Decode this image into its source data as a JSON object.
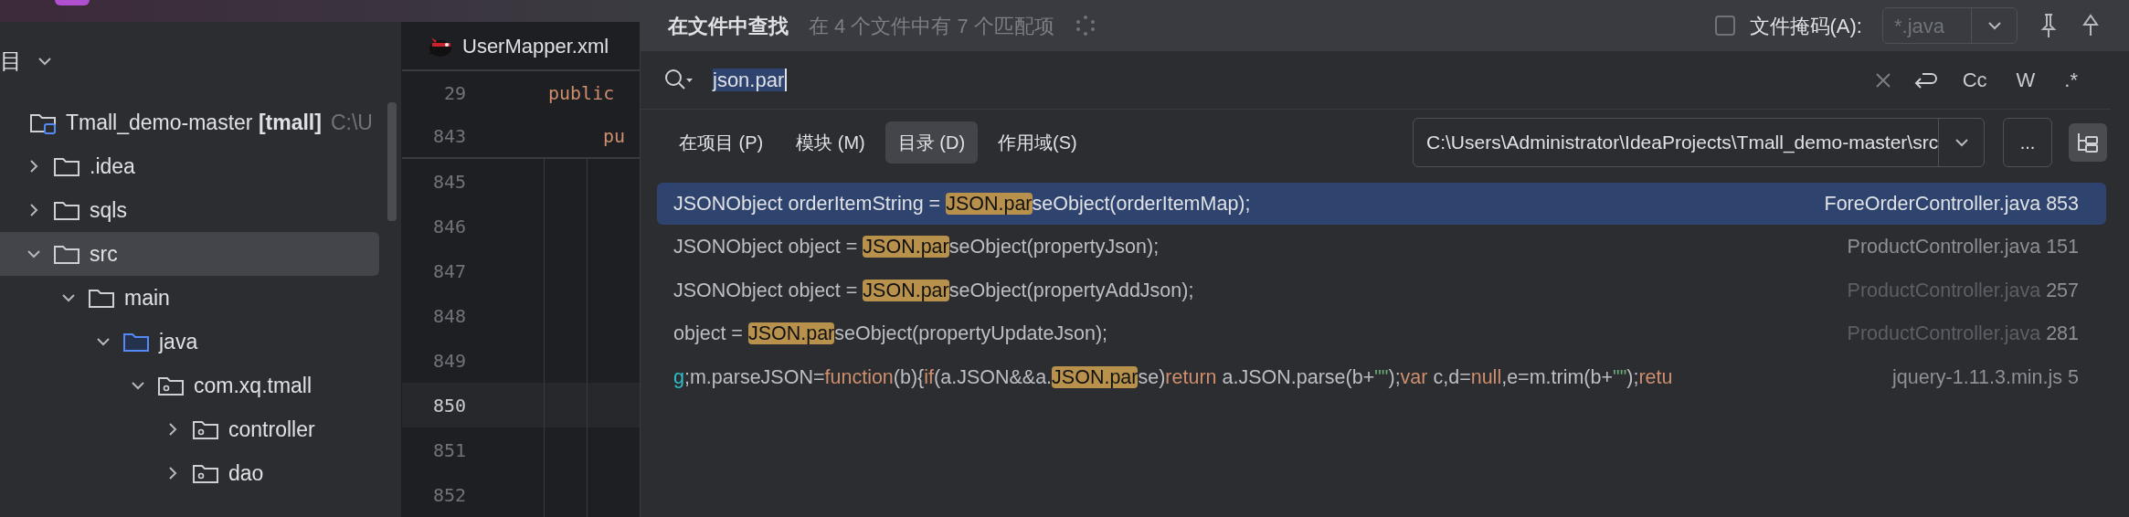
{
  "project_panel": {
    "title": "目",
    "tree": [
      {
        "label": "Tmall_demo-master **[tmall]**",
        "hint": "C:\\U",
        "kind": "module",
        "selected": false,
        "children": [
          {
            "label": ".idea",
            "kind": "folder",
            "expanded": false,
            "selected": false
          },
          {
            "label": "sqls",
            "kind": "folder",
            "expanded": false,
            "selected": false
          },
          {
            "label": "src",
            "kind": "folder",
            "expanded": true,
            "selected": true,
            "children": [
              {
                "label": "main",
                "kind": "folder",
                "expanded": true,
                "selected": false,
                "children": [
                  {
                    "label": "java",
                    "kind": "source",
                    "expanded": true,
                    "selected": false,
                    "children": [
                      {
                        "label": "com.xq.tmall",
                        "kind": "package",
                        "expanded": true,
                        "selected": false,
                        "children": [
                          {
                            "label": "controller",
                            "kind": "package",
                            "expanded": false,
                            "selected": false
                          },
                          {
                            "label": "dao",
                            "kind": "package",
                            "expanded": false,
                            "selected": false
                          }
                        ]
                      }
                    ]
                  }
                ]
              }
            ]
          }
        ]
      }
    ]
  },
  "editor": {
    "tab": {
      "label": "UserMapper.xml"
    },
    "sticky_lines": [
      {
        "number": "29",
        "code": "public"
      },
      {
        "number": "843",
        "code": "pu"
      }
    ],
    "lines": [
      {
        "number": "845",
        "current": false
      },
      {
        "number": "846",
        "current": false
      },
      {
        "number": "847",
        "current": false
      },
      {
        "number": "848",
        "current": false
      },
      {
        "number": "849",
        "current": false
      },
      {
        "number": "850",
        "current": true
      },
      {
        "number": "851",
        "current": false
      },
      {
        "number": "852",
        "current": false
      }
    ]
  },
  "find_dialog": {
    "title": "在文件中查找",
    "summary": "在 4 个文件中有 7 个匹配项",
    "file_mask": {
      "label": "文件掩码(A):",
      "checked": false,
      "value": "*.java"
    },
    "search": {
      "value": "json.par",
      "options": [
        {
          "label": "Cc"
        },
        {
          "label": "W"
        },
        {
          "label": ".*"
        }
      ]
    },
    "scopes": [
      {
        "label": "在项目 (P)",
        "selected": false
      },
      {
        "label": "模块 (M)",
        "selected": false
      },
      {
        "label": "目录 (D)",
        "selected": true
      },
      {
        "label": "作用域(S)",
        "selected": false
      }
    ],
    "directory": {
      "value": "C:\\Users\\Administrator\\IdeaProjects\\Tmall_demo-master\\src",
      "more": "..."
    },
    "results": [
      {
        "selected": true,
        "file": "ForeOrderController.java",
        "line": "853",
        "file_dimmed": false,
        "segments": [
          {
            "kind": "plain",
            "text": "JSONObject orderItemString = "
          },
          {
            "kind": "match",
            "text": "JSON.par"
          },
          {
            "kind": "plain",
            "text": "seObject(orderItemMap);"
          }
        ]
      },
      {
        "selected": false,
        "file": "ProductController.java",
        "line": "151",
        "file_dimmed": false,
        "segments": [
          {
            "kind": "plain",
            "text": "JSONObject object = "
          },
          {
            "kind": "match",
            "text": "JSON.par"
          },
          {
            "kind": "plain",
            "text": "seObject(propertyJson);"
          }
        ]
      },
      {
        "selected": false,
        "file": "ProductController.java",
        "line": "257",
        "file_dimmed": true,
        "segments": [
          {
            "kind": "plain",
            "text": "JSONObject object = "
          },
          {
            "kind": "match",
            "text": "JSON.par"
          },
          {
            "kind": "plain",
            "text": "seObject(propertyAddJson);"
          }
        ]
      },
      {
        "selected": false,
        "file": "ProductController.java",
        "line": "281",
        "file_dimmed": true,
        "segments": [
          {
            "kind": "plain",
            "text": "object = "
          },
          {
            "kind": "match",
            "text": "JSON.par"
          },
          {
            "kind": "plain",
            "text": "seObject(propertyUpdateJson);"
          }
        ]
      },
      {
        "selected": false,
        "file": "jquery-1.11.3.min.js",
        "line": "5",
        "file_dimmed": false,
        "segments": [
          {
            "kind": "identifier",
            "text": "g"
          },
          {
            "kind": "plain",
            "text": ";m.parseJSON="
          },
          {
            "kind": "keyword",
            "text": "function"
          },
          {
            "kind": "plain",
            "text": "(b){"
          },
          {
            "kind": "keyword",
            "text": "if"
          },
          {
            "kind": "plain",
            "text": "(a.JSON&&a."
          },
          {
            "kind": "match",
            "text": "JSON.par"
          },
          {
            "kind": "plain",
            "text": "se)"
          },
          {
            "kind": "keyword",
            "text": "return"
          },
          {
            "kind": "plain",
            "text": " a.JSON.parse(b+"
          },
          {
            "kind": "string",
            "text": "\"\""
          },
          {
            "kind": "plain",
            "text": ");"
          },
          {
            "kind": "keyword",
            "text": "var"
          },
          {
            "kind": "plain",
            "text": " c,d="
          },
          {
            "kind": "keyword",
            "text": "null"
          },
          {
            "kind": "plain",
            "text": ",e=m.trim(b+"
          },
          {
            "kind": "string",
            "text": "\"\""
          },
          {
            "kind": "plain",
            "text": ");"
          },
          {
            "kind": "keyword",
            "text": "retu"
          }
        ]
      }
    ]
  }
}
